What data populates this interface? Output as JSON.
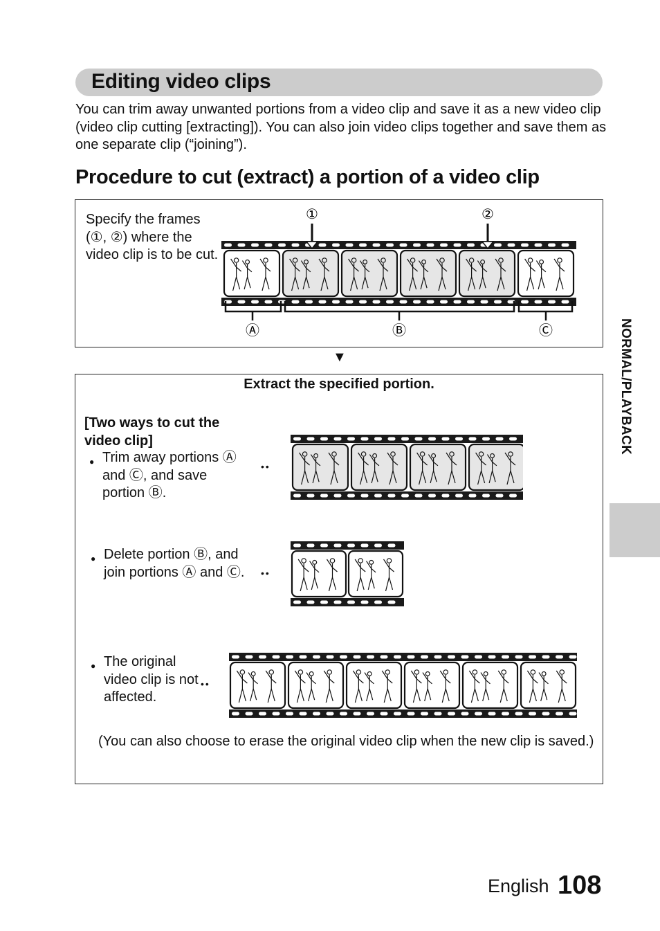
{
  "section": {
    "title": "Editing video clips",
    "intro": "You can trim away unwanted portions from a video clip and save it as a new video clip (video clip cutting [extracting]). You can also join video clips together and save them as one separate clip (“joining”)."
  },
  "procedure": {
    "title": "Procedure to cut (extract) a portion of a video clip",
    "step1": {
      "text": "Specify the frames (①, ②) where the video clip is to be cut.",
      "markers": {
        "cut1": "①",
        "cut2": "②",
        "portionA": "Ⓐ",
        "portionB": "Ⓑ",
        "portionC": "Ⓒ"
      },
      "frames": [
        {
          "highlighted": false
        },
        {
          "highlighted": true
        },
        {
          "highlighted": true
        },
        {
          "highlighted": true
        },
        {
          "highlighted": true
        },
        {
          "highlighted": false
        }
      ]
    },
    "arrow": "▼",
    "step2": {
      "title": "Extract the specified portion.",
      "ways_title": "[Two ways to cut the video clip]",
      "bullet": "●",
      "connector": "••",
      "options": [
        {
          "text": "Trim away portions Ⓐ and Ⓒ, and save portion Ⓑ.",
          "frame_count": 4,
          "highlighted": true
        },
        {
          "text": "Delete portion Ⓑ, and join portions Ⓐ and Ⓒ.",
          "frame_count": 2,
          "highlighted": false
        },
        {
          "text": "The original video clip is not affected.",
          "frame_count": 6,
          "highlighted": false
        }
      ],
      "note": "(You can also choose to erase the original video clip when the new clip is saved.)"
    }
  },
  "side_tab": {
    "label": "NORMAL/PLAYBACK",
    "color": "#cccccc"
  },
  "footer": {
    "language": "English",
    "page_number": "108"
  },
  "colors": {
    "heading_bar": "#cccccc",
    "frame_highlight": "#e6e6e6",
    "film": "#1a1a1a"
  }
}
